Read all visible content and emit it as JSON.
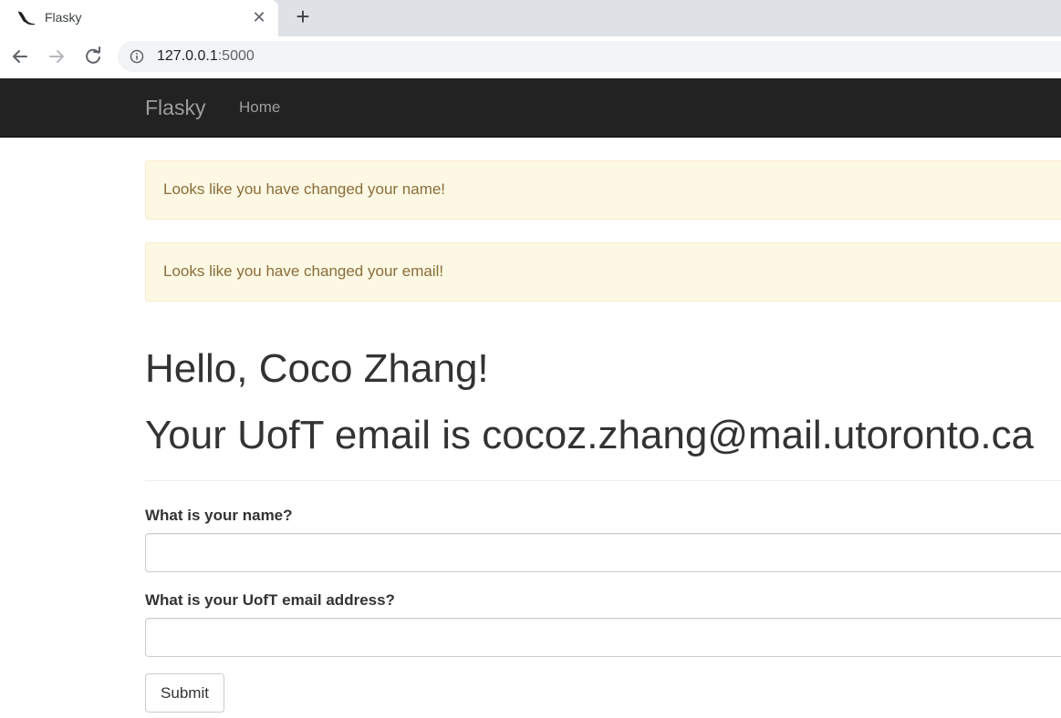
{
  "browser": {
    "tab_title": "Flasky",
    "close_glyph": "✕",
    "new_tab_glyph": "+",
    "url_host": "127.0.0.1",
    "url_port": ":5000"
  },
  "navbar": {
    "brand": "Flasky",
    "home": "Home"
  },
  "alerts": [
    "Looks like you have changed your name!",
    "Looks like you have changed your email!"
  ],
  "greeting": "Hello, Coco Zhang!",
  "email_line": "Your UofT email is cocoz.zhang@mail.utoronto.ca",
  "form": {
    "name_label": "What is your name?",
    "name_value": "",
    "email_label": "What is your UofT email address?",
    "email_value": "",
    "submit_label": "Submit"
  },
  "colors": {
    "navbar_bg": "#222222",
    "alert_bg": "#fcf8e3",
    "alert_text": "#8a6d3b"
  }
}
